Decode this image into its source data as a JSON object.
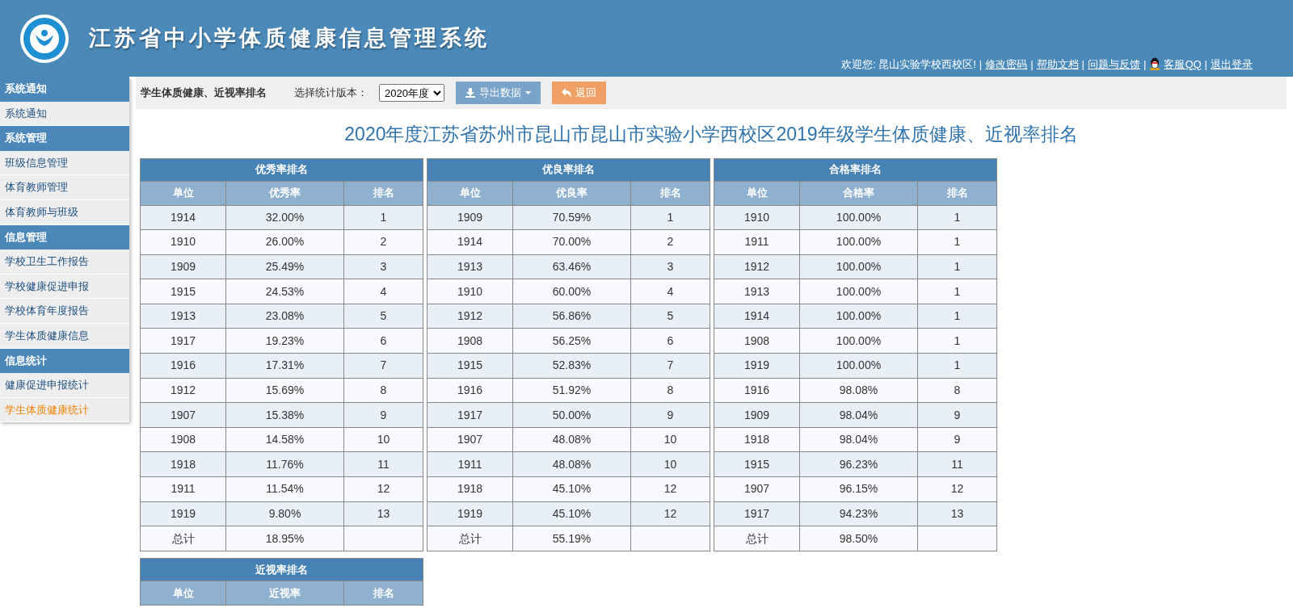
{
  "header": {
    "title": "江苏省中小学体质健康信息管理系统",
    "user_links": [
      {
        "kind": "text",
        "label": "欢迎您: 昆山实验学校西校区!"
      },
      {
        "kind": "sep",
        "label": "|"
      },
      {
        "kind": "link",
        "label": "修改密码"
      },
      {
        "kind": "sep",
        "label": "|"
      },
      {
        "kind": "link",
        "label": "帮助文档"
      },
      {
        "kind": "sep",
        "label": "|"
      },
      {
        "kind": "link",
        "label": "问题与反馈"
      },
      {
        "kind": "sep",
        "label": "|"
      },
      {
        "kind": "qq",
        "label": "客服QQ"
      },
      {
        "kind": "sep",
        "label": "|"
      },
      {
        "kind": "link",
        "label": "退出登录"
      }
    ]
  },
  "sidebar": {
    "items": [
      {
        "kind": "section",
        "label": "系统通知"
      },
      {
        "kind": "link",
        "label": "系统通知",
        "selected": false
      },
      {
        "kind": "section",
        "label": "系统管理"
      },
      {
        "kind": "link",
        "label": "班级信息管理",
        "selected": false
      },
      {
        "kind": "link",
        "label": "体育教师管理",
        "selected": false
      },
      {
        "kind": "link",
        "label": "体育教师与班级",
        "selected": false
      },
      {
        "kind": "section",
        "label": "信息管理"
      },
      {
        "kind": "link",
        "label": "学校卫生工作报告",
        "selected": false
      },
      {
        "kind": "link",
        "label": "学校健康促进申报",
        "selected": false
      },
      {
        "kind": "link",
        "label": "学校体育年度报告",
        "selected": false
      },
      {
        "kind": "link",
        "label": "学生体质健康信息",
        "selected": false
      },
      {
        "kind": "section",
        "label": "信息统计"
      },
      {
        "kind": "link",
        "label": "健康促进申报统计",
        "selected": false
      },
      {
        "kind": "link",
        "label": "学生体质健康统计",
        "selected": true
      }
    ]
  },
  "toolbar": {
    "title": "学生体质健康、近视率排名",
    "version_label": "选择统计版本：",
    "version_value": "2020年度",
    "export_button": "导出数据",
    "back_button": "返回"
  },
  "report": {
    "title": "2020年度江苏省苏州市昆山市昆山市实验小学西校区2019年级学生体质健康、近视率排名",
    "tables": [
      {
        "title": "优秀率排名",
        "columns": [
          "单位",
          "优秀率",
          "排名"
        ],
        "rows": [
          [
            "1914",
            "32.00%",
            "1"
          ],
          [
            "1910",
            "26.00%",
            "2"
          ],
          [
            "1909",
            "25.49%",
            "3"
          ],
          [
            "1915",
            "24.53%",
            "4"
          ],
          [
            "1913",
            "23.08%",
            "5"
          ],
          [
            "1917",
            "19.23%",
            "6"
          ],
          [
            "1916",
            "17.31%",
            "7"
          ],
          [
            "1912",
            "15.69%",
            "8"
          ],
          [
            "1907",
            "15.38%",
            "9"
          ],
          [
            "1908",
            "14.58%",
            "10"
          ],
          [
            "1918",
            "11.76%",
            "11"
          ],
          [
            "1911",
            "11.54%",
            "12"
          ],
          [
            "1919",
            "9.80%",
            "13"
          ],
          [
            "总计",
            "18.95%"
          ]
        ]
      },
      {
        "title": "优良率排名",
        "columns": [
          "单位",
          "优良率",
          "排名"
        ],
        "rows": [
          [
            "1909",
            "70.59%",
            "1"
          ],
          [
            "1914",
            "70.00%",
            "2"
          ],
          [
            "1913",
            "63.46%",
            "3"
          ],
          [
            "1910",
            "60.00%",
            "4"
          ],
          [
            "1912",
            "56.86%",
            "5"
          ],
          [
            "1908",
            "56.25%",
            "6"
          ],
          [
            "1915",
            "52.83%",
            "7"
          ],
          [
            "1916",
            "51.92%",
            "8"
          ],
          [
            "1917",
            "50.00%",
            "9"
          ],
          [
            "1907",
            "48.08%",
            "10"
          ],
          [
            "1911",
            "48.08%",
            "10"
          ],
          [
            "1918",
            "45.10%",
            "12"
          ],
          [
            "1919",
            "45.10%",
            "12"
          ],
          [
            "总计",
            "55.19%"
          ]
        ]
      },
      {
        "title": "合格率排名",
        "columns": [
          "单位",
          "合格率",
          "排名"
        ],
        "rows": [
          [
            "1910",
            "100.00%",
            "1"
          ],
          [
            "1911",
            "100.00%",
            "1"
          ],
          [
            "1912",
            "100.00%",
            "1"
          ],
          [
            "1913",
            "100.00%",
            "1"
          ],
          [
            "1914",
            "100.00%",
            "1"
          ],
          [
            "1908",
            "100.00%",
            "1"
          ],
          [
            "1919",
            "100.00%",
            "1"
          ],
          [
            "1916",
            "98.08%",
            "8"
          ],
          [
            "1909",
            "98.04%",
            "9"
          ],
          [
            "1918",
            "98.04%",
            "9"
          ],
          [
            "1915",
            "96.23%",
            "11"
          ],
          [
            "1907",
            "96.15%",
            "12"
          ],
          [
            "1917",
            "94.23%",
            "13"
          ],
          [
            "总计",
            "98.50%"
          ]
        ]
      },
      {
        "title": "近视率排名",
        "columns": [
          "单位",
          "近视率",
          "排名"
        ]
      }
    ]
  }
}
